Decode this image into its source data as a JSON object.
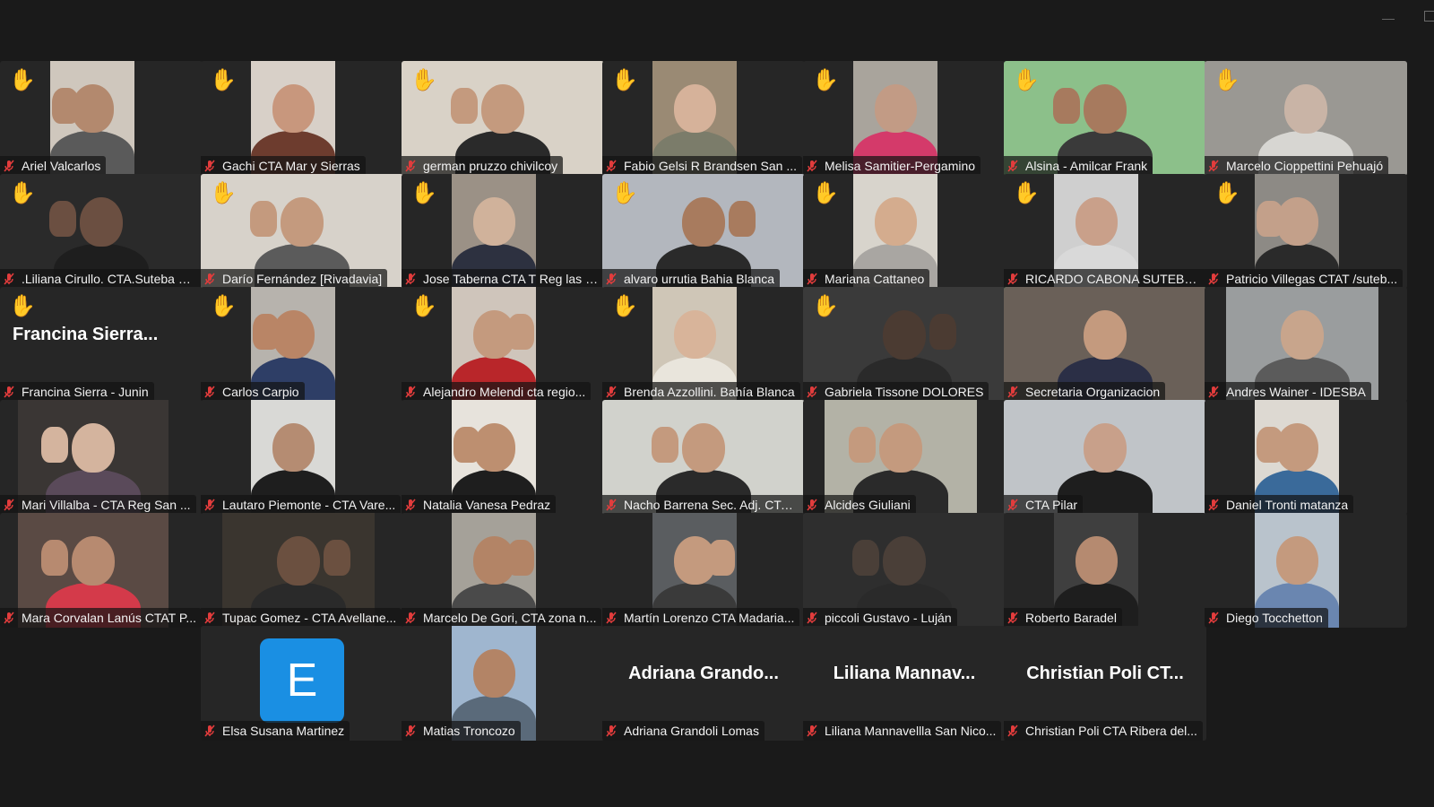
{
  "window": {
    "minimize_glyph": "—"
  },
  "icons": {
    "raised_hand": "raised-hand-icon",
    "muted_mic": "mic-muted-icon"
  },
  "colors": {
    "raise_hand": "#f6c22e",
    "mute": "#e23c3c",
    "active_speaker": "#22d06b",
    "avatar_e": "#1a8fe3"
  },
  "tiles": [
    {
      "name": "Ariel Valcarlos",
      "hand": true
    },
    {
      "name": "Gachi CTA Mar y Sierras",
      "hand": true
    },
    {
      "name": "german pruzzo chivilcoy",
      "hand": true
    },
    {
      "name": "Fabio Gelsi R Brandsen San ...",
      "hand": true
    },
    {
      "name": "Melisa Samitier-Pergamino",
      "hand": true
    },
    {
      "name": "Alsina - Amilcar Frank",
      "hand": true
    },
    {
      "name": "Marcelo Cioppettini Pehuajó",
      "hand": true
    },
    {
      "name": ".Liliana Cirullo. CTA.Suteba R...",
      "hand": true
    },
    {
      "name": "Darío Fernández [Rivadavia]",
      "hand": true
    },
    {
      "name": "Jose Taberna CTA T Reg las h...",
      "hand": true
    },
    {
      "name": "alvaro urrutia Bahia Blanca",
      "hand": true
    },
    {
      "name": "Mariana Cattaneo",
      "hand": true
    },
    {
      "name": "RICARDO CABONA SUTEBA ...",
      "hand": true
    },
    {
      "name": "Patricio Villegas CTAT /suteb...",
      "hand": true
    },
    {
      "name": "Francina Sierra - Junin",
      "hand": true,
      "display_name": "Francina  Sierra..."
    },
    {
      "name": "Carlos Carpio",
      "hand": true
    },
    {
      "name": "Alejandro Melendi cta regio...",
      "hand": true
    },
    {
      "name": "Brenda Azzollini. Bahía Blanca",
      "hand": true
    },
    {
      "name": "Gabriela Tissone  DOLORES",
      "hand": true
    },
    {
      "name": "Secretaria Organizacion",
      "hand": false,
      "active": true
    },
    {
      "name": "Andres Wainer - IDESBA",
      "hand": false
    },
    {
      "name": "Mari Villalba - CTA Reg San ...",
      "hand": false
    },
    {
      "name": "Lautaro Piemonte - CTA Vare...",
      "hand": false
    },
    {
      "name": "Natalia Vanesa Pedraz",
      "hand": false
    },
    {
      "name": "Nacho Barrena Sec. Adj. CTA ...",
      "hand": false
    },
    {
      "name": "Alcides Giuliani",
      "hand": false
    },
    {
      "name": "CTA  Pilar",
      "hand": false
    },
    {
      "name": "Daniel Tronti matanza",
      "hand": false
    },
    {
      "name": "Mara Corvalan Lanús CTAT P...",
      "hand": false
    },
    {
      "name": "Tupac Gomez - CTA Avellane...",
      "hand": false
    },
    {
      "name": "Marcelo De Gori, CTA zona n...",
      "hand": false
    },
    {
      "name": "Martín Lorenzo CTA Madaria...",
      "hand": false
    },
    {
      "name": "piccoli Gustavo - Luján",
      "hand": false
    },
    {
      "name": "Roberto Baradel",
      "hand": false
    },
    {
      "name": "Diego Tocchetton",
      "hand": false
    },
    {
      "name": "Elsa Susana Martinez",
      "hand": false,
      "avatar_letter": "E"
    },
    {
      "name": "Matias Troncozo",
      "hand": false
    },
    {
      "name": "Adriana Grandoli Lomas",
      "hand": false,
      "display_name": "Adriana  Grando..."
    },
    {
      "name": "Liliana Mannavellla San Nico...",
      "hand": false,
      "display_name": "Liliana  Mannav..."
    },
    {
      "name": "Christian Poli CTA Ribera del...",
      "hand": false,
      "display_name": "Christian  Poli  CT..."
    }
  ]
}
